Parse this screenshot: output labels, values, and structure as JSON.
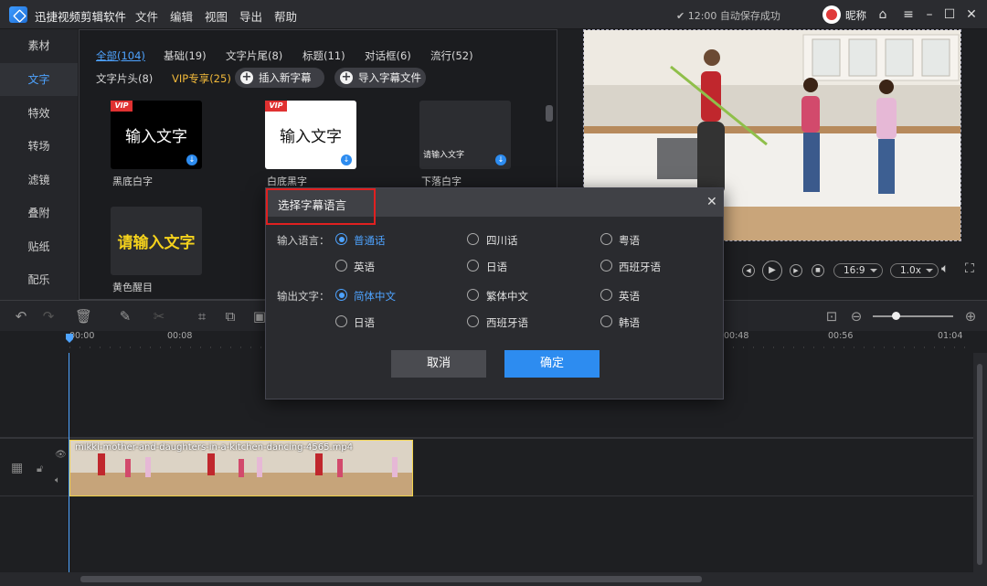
{
  "app": {
    "title": "迅捷视频剪辑软件",
    "menu": [
      "文件",
      "编辑",
      "视图",
      "导出",
      "帮助"
    ],
    "autosave": "✔ 12:00 自动保存成功",
    "user": "昵称"
  },
  "sidebar": {
    "items": [
      {
        "label": "素材"
      },
      {
        "label": "文字"
      },
      {
        "label": "特效"
      },
      {
        "label": "转场"
      },
      {
        "label": "滤镜"
      },
      {
        "label": "叠附"
      },
      {
        "label": "贴纸"
      },
      {
        "label": "配乐"
      }
    ]
  },
  "panel": {
    "filters": [
      "全部(104)",
      "基础(19)",
      "文字片尾(8)",
      "标题(11)",
      "对话框(6)",
      "流行(52)",
      "文字片头(8)",
      "VIP专享(25)"
    ],
    "insert_button": "插入新字幕",
    "import_button": "导入字幕文件",
    "templates": [
      {
        "thumb_text": "输入文字",
        "label": "黑底白字",
        "vip": "VIP"
      },
      {
        "thumb_text": "输入文字",
        "label": "白底黑字",
        "vip": "VIP"
      },
      {
        "thumb_text": "请输入文字",
        "label": "下落白字"
      },
      {
        "thumb_text": "请输入文字",
        "label": "黄色醒目"
      }
    ]
  },
  "player": {
    "ratio": "16:9",
    "speed": "1.0x"
  },
  "timeline": {
    "ticks": [
      "00:00",
      "00:08",
      "00:48",
      "00:56",
      "01:04"
    ],
    "clip_name": "mikki-mother-and-daughters-in-a-kitchen-dancing-4565.mp4"
  },
  "dialog": {
    "title": "选择字幕语言",
    "input_label": "输入语言：",
    "input_options": [
      "普通话",
      "四川话",
      "粤语",
      "英语",
      "日语",
      "西班牙语"
    ],
    "input_selected": "普通话",
    "output_label": "输出文字：",
    "output_options": [
      "简体中文",
      "繁体中文",
      "英语",
      "日语",
      "西班牙语",
      "韩语"
    ],
    "output_selected": "简体中文",
    "cancel": "取消",
    "confirm": "确定"
  },
  "colors": {
    "accent": "#4ea3ff",
    "confirm_button": "#2d8cf0",
    "cancel_button": "#4a4b50",
    "highlight_box": "#e02020",
    "vip": "#f1b93a"
  }
}
